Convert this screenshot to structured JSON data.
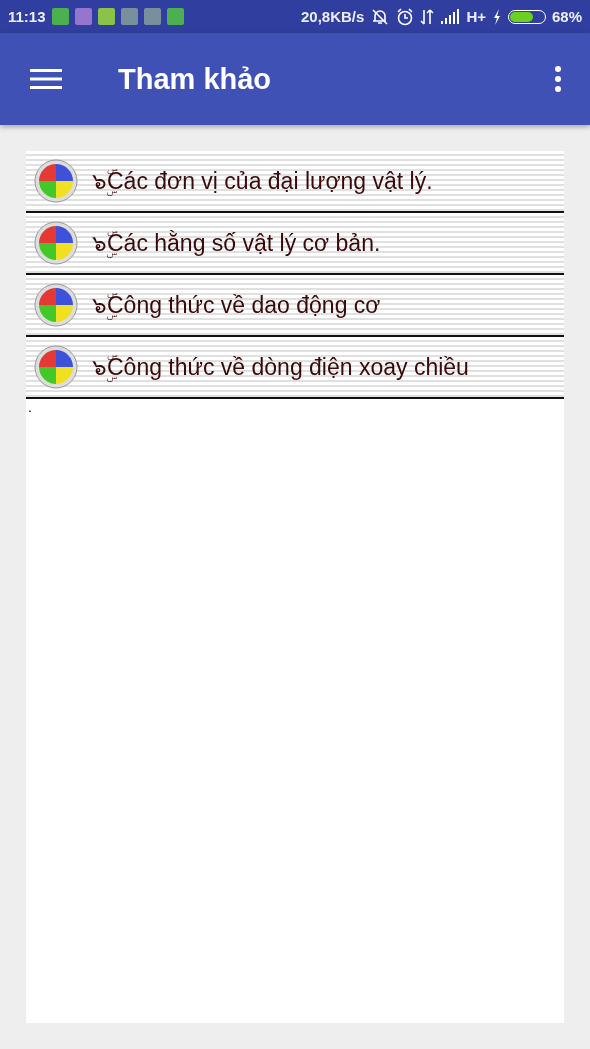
{
  "status_bar": {
    "time": "11:13",
    "speed": "20,8KB/s",
    "network": "H+",
    "battery": {
      "text": "68%",
      "level": 0.68
    }
  },
  "app_bar": {
    "title": "Tham khảo"
  },
  "items": [
    {
      "label": "๖ۣۜCác đơn vị của đại lượng vật lý."
    },
    {
      "label": "๖ۣۜCác hằng số vật lý cơ bản."
    },
    {
      "label": "๖ۣۜCông thức về dao động cơ"
    },
    {
      "label": "๖ۣۜCông thức về dòng điện xoay chiều"
    }
  ],
  "footer_text": "."
}
